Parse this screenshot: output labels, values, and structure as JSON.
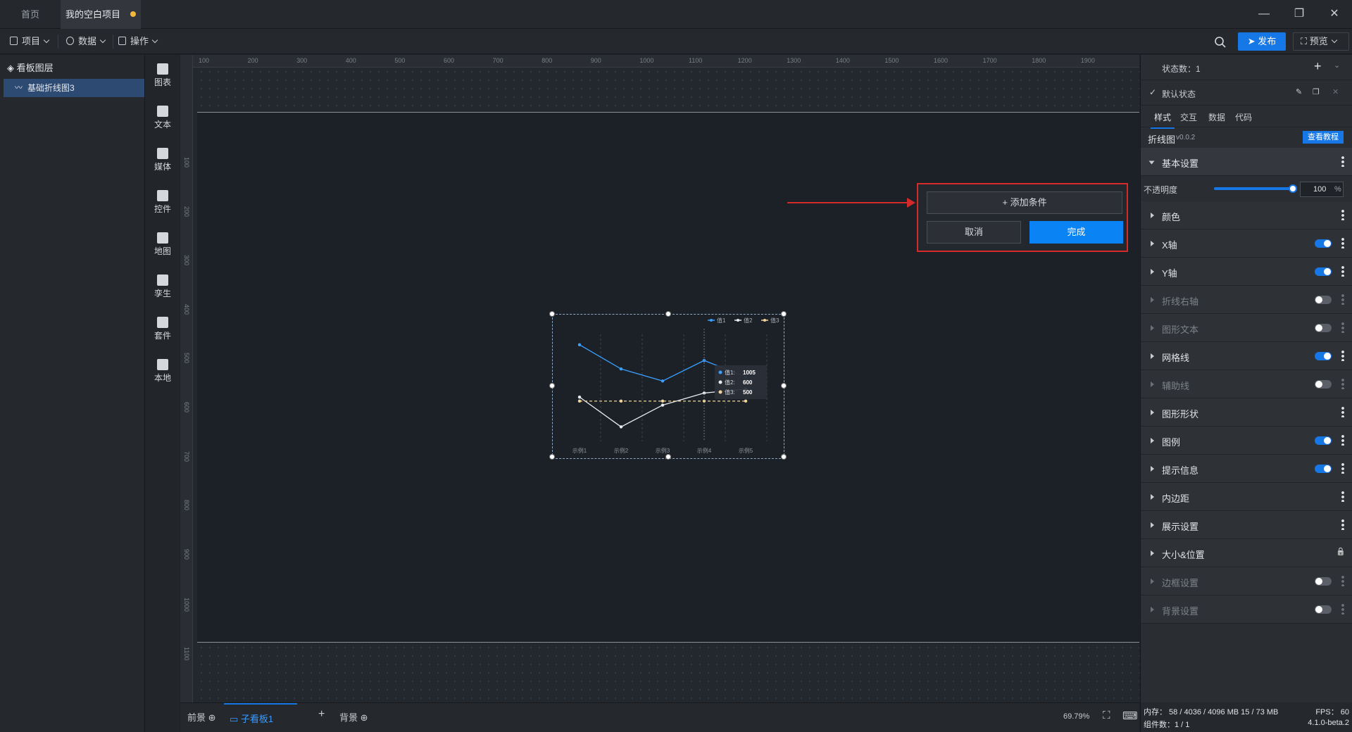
{
  "tabs": [
    {
      "label": "首页"
    },
    {
      "label": "我的空白项目",
      "unsaved": true
    }
  ],
  "menubar": {
    "project": "项目",
    "data": "数据",
    "operate": "操作",
    "publish": "发布",
    "preview": "预览"
  },
  "layers": {
    "title": "看板图层",
    "items": [
      "基础折线图3"
    ]
  },
  "iconbar": [
    {
      "label": "图表",
      "icon": "chart-icon"
    },
    {
      "label": "文本",
      "icon": "text-icon"
    },
    {
      "label": "媒体",
      "icon": "media-icon"
    },
    {
      "label": "控件",
      "icon": "control-icon"
    },
    {
      "label": "地图",
      "icon": "map-icon"
    },
    {
      "label": "孪生",
      "icon": "twin-icon"
    },
    {
      "label": "套件",
      "icon": "kit-icon"
    },
    {
      "label": "本地",
      "icon": "local-icon"
    }
  ],
  "ruler_h_ticks": [
    "100",
    "200",
    "300",
    "400",
    "500",
    "600",
    "700",
    "800",
    "900",
    "1000",
    "1100",
    "1200",
    "1300",
    "1400",
    "1500",
    "1600",
    "1700",
    "1800",
    "1900"
  ],
  "ruler_v_ticks": [
    "100",
    "200",
    "300",
    "400",
    "500",
    "600",
    "700",
    "800",
    "900",
    "1000",
    "1100"
  ],
  "chart_data": {
    "type": "line",
    "categories": [
      "示例1",
      "示例2",
      "示例3",
      "示例4",
      "示例5"
    ],
    "series": [
      {
        "name": "值1",
        "values": [
          1200,
          900,
          750,
          1005,
          800
        ],
        "color": "#3aa0ff"
      },
      {
        "name": "值2",
        "values": [
          550,
          180,
          450,
          600,
          650
        ],
        "color": "#e8ecf2"
      },
      {
        "name": "值3",
        "values": [
          500,
          500,
          500,
          500,
          500
        ],
        "color": "#f0d49a",
        "dashed": true
      }
    ],
    "tooltip": [
      {
        "name": "值1:",
        "value": "1005"
      },
      {
        "name": "值2:",
        "value": "600"
      },
      {
        "name": "值3:",
        "value": "500"
      }
    ]
  },
  "popup": {
    "add_condition": "添加条件",
    "cancel": "取消",
    "done": "完成"
  },
  "bottom": {
    "foreground": "前景",
    "subboard": "子看板1",
    "background": "背景",
    "zoom": "69.79%"
  },
  "rightpanel": {
    "state_count": "状态数：1",
    "default_state": "默认状态",
    "tabs": [
      "样式",
      "交互",
      "数据",
      "代码"
    ],
    "component_name": "折线图",
    "version": "v0.0.2",
    "tutorial": "查看教程",
    "basic": "基本设置",
    "opacity_label": "不透明度",
    "opacity_value": "100",
    "opacity_unit": "%",
    "opacity_level": 1.0,
    "sections": [
      {
        "label": "颜色",
        "toggle": null,
        "dim": false
      },
      {
        "label": "X轴",
        "toggle": true,
        "dim": false
      },
      {
        "label": "Y轴",
        "toggle": true,
        "dim": false
      },
      {
        "label": "折线右轴",
        "toggle": false,
        "dim": true
      },
      {
        "label": "图形文本",
        "toggle": false,
        "dim": true
      },
      {
        "label": "网格线",
        "toggle": true,
        "dim": false
      },
      {
        "label": "辅助线",
        "toggle": false,
        "dim": true
      },
      {
        "label": "图形形状",
        "toggle": null,
        "dim": false
      },
      {
        "label": "图例",
        "toggle": true,
        "dim": false
      },
      {
        "label": "提示信息",
        "toggle": true,
        "dim": false
      },
      {
        "label": "内边距",
        "toggle": null,
        "dim": false
      },
      {
        "label": "展示设置",
        "toggle": null,
        "dim": false
      },
      {
        "label": "大小&位置",
        "toggle": null,
        "dim": false,
        "lock": true
      },
      {
        "label": "边框设置",
        "toggle": false,
        "dim": true
      },
      {
        "label": "背景设置",
        "toggle": false,
        "dim": true
      }
    ]
  },
  "status": {
    "memory": "内存： 58 / 4036 / 4096 MB 15 / 73 MB",
    "fps": "FPS： 60",
    "components": "组件数：1 / 1",
    "version": "4.1.0-beta.2"
  }
}
